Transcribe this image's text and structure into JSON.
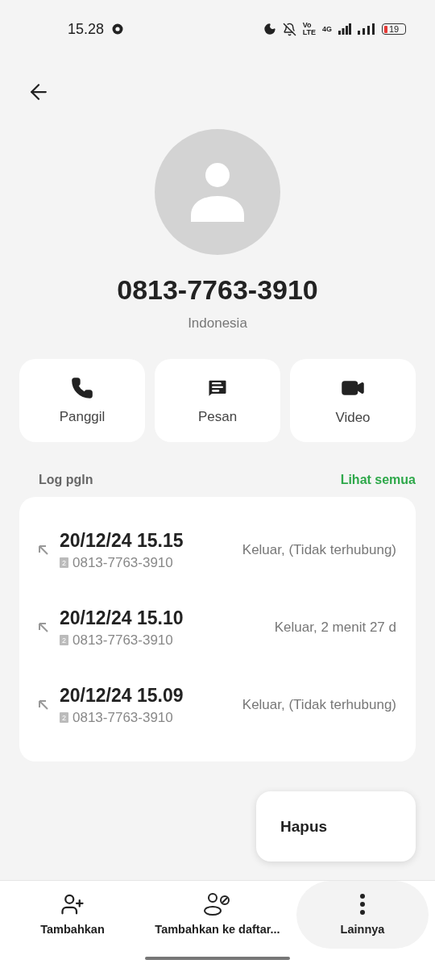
{
  "status_bar": {
    "time": "15.28",
    "network_badge": "Vo",
    "network_badge_2": "LTE",
    "network_type": "4G",
    "battery": "19"
  },
  "contact": {
    "number": "0813-7763-3910",
    "country": "Indonesia"
  },
  "actions": [
    {
      "kind": "call",
      "label": "Panggil"
    },
    {
      "kind": "message",
      "label": "Pesan"
    },
    {
      "kind": "video",
      "label": "Video"
    }
  ],
  "call_log": {
    "title": "Log pgln",
    "link": "Lihat semua",
    "entries": [
      {
        "datetime": "20/12/24 15.15",
        "sim": "2",
        "number": "0813-7763-3910",
        "status": "Keluar, (Tidak terhubung)"
      },
      {
        "datetime": "20/12/24 15.10",
        "sim": "2",
        "number": "0813-7763-3910",
        "status": "Keluar,  2 menit 27 d"
      },
      {
        "datetime": "20/12/24 15.09",
        "sim": "2",
        "number": "0813-7763-3910",
        "status": "Keluar, (Tidak terhubung)"
      }
    ]
  },
  "popup_menu": {
    "items": [
      "Hapus"
    ]
  },
  "bottom_bar": [
    {
      "kind": "add",
      "label": "Tambahkan",
      "pressed": false
    },
    {
      "kind": "block",
      "label": "Tambahkan ke daftar...",
      "pressed": false
    },
    {
      "kind": "more",
      "label": "Lainnya",
      "pressed": true
    }
  ]
}
